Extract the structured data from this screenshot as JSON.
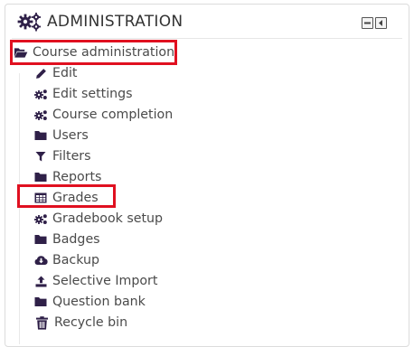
{
  "block": {
    "title": "ADMINISTRATION"
  },
  "tree": {
    "root": {
      "label": "Course administration",
      "icon": "folder-open-icon"
    },
    "items": [
      {
        "label": "Edit",
        "icon": "pencil-icon"
      },
      {
        "label": "Edit settings",
        "icon": "cog-icon"
      },
      {
        "label": "Course completion",
        "icon": "cog-icon"
      },
      {
        "label": "Users",
        "icon": "folder-icon"
      },
      {
        "label": "Filters",
        "icon": "filter-icon"
      },
      {
        "label": "Reports",
        "icon": "folder-icon"
      },
      {
        "label": "Grades",
        "icon": "table-icon"
      },
      {
        "label": "Gradebook setup",
        "icon": "cog-icon"
      },
      {
        "label": "Badges",
        "icon": "folder-icon"
      },
      {
        "label": "Backup",
        "icon": "cloud-download-icon"
      },
      {
        "label": "Selective Import",
        "icon": "upload-icon"
      },
      {
        "label": "Question bank",
        "icon": "folder-icon"
      },
      {
        "label": "Recycle bin",
        "icon": "trash-icon"
      }
    ]
  },
  "colors": {
    "icon": "#2f2048",
    "text": "#4a4a4a",
    "highlight": "#e01020"
  }
}
